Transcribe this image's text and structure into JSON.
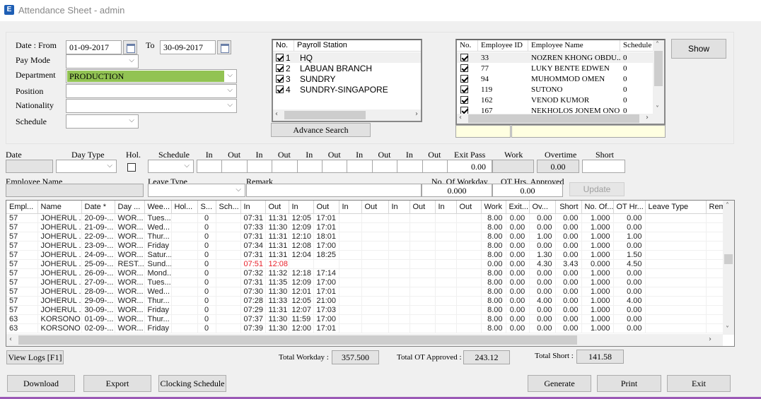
{
  "window": {
    "title": "Attendance Sheet - admin",
    "icon_letter": "E"
  },
  "filters": {
    "date_from_label": "Date : From",
    "date_from": "01-09-2017",
    "to_label": "To",
    "date_to": "30-09-2017",
    "pay_mode_label": "Pay Mode",
    "pay_mode": "",
    "department_label": "Department",
    "department": "PRODUCTION",
    "position_label": "Position",
    "position": "",
    "nationality_label": "Nationality",
    "nationality": "",
    "schedule_label": "Schedule",
    "schedule": "",
    "department_highlight": "#92c353"
  },
  "payroll_stations": {
    "headers": [
      "No.",
      "Payroll Station"
    ],
    "rows": [
      {
        "no": "1",
        "name": "HQ",
        "checked": true
      },
      {
        "no": "2",
        "name": "LABUAN BRANCH",
        "checked": true
      },
      {
        "no": "3",
        "name": "SUNDRY",
        "checked": true
      },
      {
        "no": "4",
        "name": "SUNDRY-SINGAPORE",
        "checked": true
      }
    ],
    "advance_search_label": "Advance Search"
  },
  "employees": {
    "headers": [
      "No.",
      "Employee ID",
      "Employee Name",
      "Schedule"
    ],
    "rows": [
      {
        "id": "33",
        "name": "NOZREN KHONG OBDU...",
        "schedule": "0",
        "checked": true
      },
      {
        "id": "77",
        "name": "LUKY BENTE EDWEN",
        "schedule": "0",
        "checked": true
      },
      {
        "id": "94",
        "name": "MUHOMMOD OMEN",
        "schedule": "0",
        "checked": true
      },
      {
        "id": "119",
        "name": "SUTONO",
        "schedule": "0",
        "checked": true
      },
      {
        "id": "162",
        "name": "VENOD KUMOR",
        "schedule": "0",
        "checked": true
      },
      {
        "id": "167",
        "name": "NEKHOLOS JONEM ONO",
        "schedule": "0",
        "checked": true
      }
    ],
    "search_id": "",
    "search_name": ""
  },
  "show_label": "Show",
  "editor": {
    "date_label": "Date",
    "day_type_label": "Day Type",
    "hol_label": "Hol.",
    "schedule_label": "Schedule",
    "in_label": "In",
    "out_label": "Out",
    "exit_pass_label": "Exit Pass",
    "exit_pass": "0.00",
    "work_label": "Work",
    "work": "",
    "overtime_label": "Overtime",
    "overtime": "0.00",
    "short_label": "Short",
    "short": "",
    "employee_name_label": "Employee Name",
    "leave_type_label": "Leave Type",
    "remark_label": "Remark",
    "workday_label": "No. Of Workday",
    "workday": "0.000",
    "ot_approved_label": "OT Hrs. Approved",
    "ot_approved": "0.00",
    "update_label": "Update"
  },
  "grid": {
    "headers": [
      "Empl...",
      "Name",
      "Date *",
      "Day ...",
      "Wee...",
      "Hol...",
      "S...",
      "Sch...",
      "In",
      "Out",
      "In",
      "Out",
      "In",
      "Out",
      "In",
      "Out",
      "In",
      "Out",
      "Work",
      "Exit...",
      "Ov...",
      "Short",
      "No. Of...",
      "OT Hr...",
      "Leave Type",
      "Remark"
    ],
    "rows": [
      {
        "emp": "57",
        "name": "JOHERUL ...",
        "date": "20-09-...",
        "day": "WOR...",
        "week": "Tues...",
        "hol": "",
        "s": "0",
        "sch": "",
        "t": [
          "07:31",
          "11:31",
          "12:05",
          "17:01"
        ],
        "work": "8.00",
        "exit": "0.00",
        "ov": "0.00",
        "short": "0.00",
        "no": "1.000",
        "ot": "0.00",
        "leave": "",
        "remark": "",
        "red": false
      },
      {
        "emp": "57",
        "name": "JOHERUL ...",
        "date": "21-09-...",
        "day": "WOR...",
        "week": "Wed...",
        "hol": "",
        "s": "0",
        "sch": "",
        "t": [
          "07:33",
          "11:30",
          "12:09",
          "17:01"
        ],
        "work": "8.00",
        "exit": "0.00",
        "ov": "0.00",
        "short": "0.00",
        "no": "1.000",
        "ot": "0.00",
        "leave": "",
        "remark": "",
        "red": false
      },
      {
        "emp": "57",
        "name": "JOHERUL ...",
        "date": "22-09-...",
        "day": "WOR...",
        "week": "Thur...",
        "hol": "",
        "s": "0",
        "sch": "",
        "t": [
          "07:31",
          "11:31",
          "12:10",
          "18:01"
        ],
        "work": "8.00",
        "exit": "0.00",
        "ov": "1.00",
        "short": "0.00",
        "no": "1.000",
        "ot": "1.00",
        "leave": "",
        "remark": "",
        "red": false
      },
      {
        "emp": "57",
        "name": "JOHERUL ...",
        "date": "23-09-...",
        "day": "WOR...",
        "week": "Friday",
        "hol": "",
        "s": "0",
        "sch": "",
        "t": [
          "07:34",
          "11:31",
          "12:08",
          "17:00"
        ],
        "work": "8.00",
        "exit": "0.00",
        "ov": "0.00",
        "short": "0.00",
        "no": "1.000",
        "ot": "0.00",
        "leave": "",
        "remark": "",
        "red": false
      },
      {
        "emp": "57",
        "name": "JOHERUL ...",
        "date": "24-09-...",
        "day": "WOR...",
        "week": "Satur...",
        "hol": "",
        "s": "0",
        "sch": "",
        "t": [
          "07:31",
          "11:31",
          "12:04",
          "18:25"
        ],
        "work": "8.00",
        "exit": "0.00",
        "ov": "1.30",
        "short": "0.00",
        "no": "1.000",
        "ot": "1.50",
        "leave": "",
        "remark": "",
        "red": false
      },
      {
        "emp": "57",
        "name": "JOHERUL ...",
        "date": "25-09-...",
        "day": "REST...",
        "week": "Sund...",
        "hol": "",
        "s": "0",
        "sch": "",
        "t": [
          "07:51",
          "12:08",
          "",
          ""
        ],
        "work": "0.00",
        "exit": "0.00",
        "ov": "4.30",
        "short": "3.43",
        "no": "0.000",
        "ot": "4.50",
        "leave": "",
        "remark": "",
        "red": true
      },
      {
        "emp": "57",
        "name": "JOHERUL ...",
        "date": "26-09-...",
        "day": "WOR...",
        "week": "Mond...",
        "hol": "",
        "s": "0",
        "sch": "",
        "t": [
          "07:32",
          "11:32",
          "12:18",
          "17:14"
        ],
        "work": "8.00",
        "exit": "0.00",
        "ov": "0.00",
        "short": "0.00",
        "no": "1.000",
        "ot": "0.00",
        "leave": "",
        "remark": "",
        "red": false
      },
      {
        "emp": "57",
        "name": "JOHERUL ...",
        "date": "27-09-...",
        "day": "WOR...",
        "week": "Tues...",
        "hol": "",
        "s": "0",
        "sch": "",
        "t": [
          "07:31",
          "11:35",
          "12:09",
          "17:00"
        ],
        "work": "8.00",
        "exit": "0.00",
        "ov": "0.00",
        "short": "0.00",
        "no": "1.000",
        "ot": "0.00",
        "leave": "",
        "remark": "",
        "red": false
      },
      {
        "emp": "57",
        "name": "JOHERUL ...",
        "date": "28-09-...",
        "day": "WOR...",
        "week": "Wed...",
        "hol": "",
        "s": "0",
        "sch": "",
        "t": [
          "07:30",
          "11:30",
          "12:01",
          "17:01"
        ],
        "work": "8.00",
        "exit": "0.00",
        "ov": "0.00",
        "short": "0.00",
        "no": "1.000",
        "ot": "0.00",
        "leave": "",
        "remark": "",
        "red": false
      },
      {
        "emp": "57",
        "name": "JOHERUL ...",
        "date": "29-09-...",
        "day": "WOR...",
        "week": "Thur...",
        "hol": "",
        "s": "0",
        "sch": "",
        "t": [
          "07:28",
          "11:33",
          "12:05",
          "21:00"
        ],
        "work": "8.00",
        "exit": "0.00",
        "ov": "4.00",
        "short": "0.00",
        "no": "1.000",
        "ot": "4.00",
        "leave": "",
        "remark": "",
        "red": false
      },
      {
        "emp": "57",
        "name": "JOHERUL ...",
        "date": "30-09-...",
        "day": "WOR...",
        "week": "Friday",
        "hol": "",
        "s": "0",
        "sch": "",
        "t": [
          "07:29",
          "11:31",
          "12:07",
          "17:03"
        ],
        "work": "8.00",
        "exit": "0.00",
        "ov": "0.00",
        "short": "0.00",
        "no": "1.000",
        "ot": "0.00",
        "leave": "",
        "remark": "",
        "red": false
      },
      {
        "emp": "63",
        "name": "KORSONO",
        "date": "01-09-...",
        "day": "WOR...",
        "week": "Thur...",
        "hol": "",
        "s": "0",
        "sch": "",
        "t": [
          "07:37",
          "11:30",
          "11:59",
          "17:00"
        ],
        "work": "8.00",
        "exit": "0.00",
        "ov": "0.00",
        "short": "0.00",
        "no": "1.000",
        "ot": "0.00",
        "leave": "",
        "remark": "",
        "red": false
      },
      {
        "emp": "63",
        "name": "KORSONO",
        "date": "02-09-...",
        "day": "WOR...",
        "week": "Friday",
        "hol": "",
        "s": "0",
        "sch": "",
        "t": [
          "07:39",
          "11:30",
          "12:00",
          "17:01"
        ],
        "work": "8.00",
        "exit": "0.00",
        "ov": "0.00",
        "short": "0.00",
        "no": "1.000",
        "ot": "0.00",
        "leave": "",
        "remark": "",
        "red": false
      }
    ]
  },
  "footer": {
    "view_logs_label": "View Logs [F1]",
    "total_workday_label": "Total Workday :",
    "total_workday": "357.500",
    "total_ot_label": "Total OT Approved :",
    "total_ot": "243.12",
    "total_short_label": "Total Short :",
    "total_short": "141.58",
    "download_label": "Download",
    "export_label": "Export",
    "clocking_schedule_label": "Clocking Schedule",
    "generate_label": "Generate",
    "print_label": "Print",
    "exit_label": "Exit"
  },
  "colors": {
    "late_time": "#e8202a",
    "accent_bottom": "#9b59b6"
  }
}
